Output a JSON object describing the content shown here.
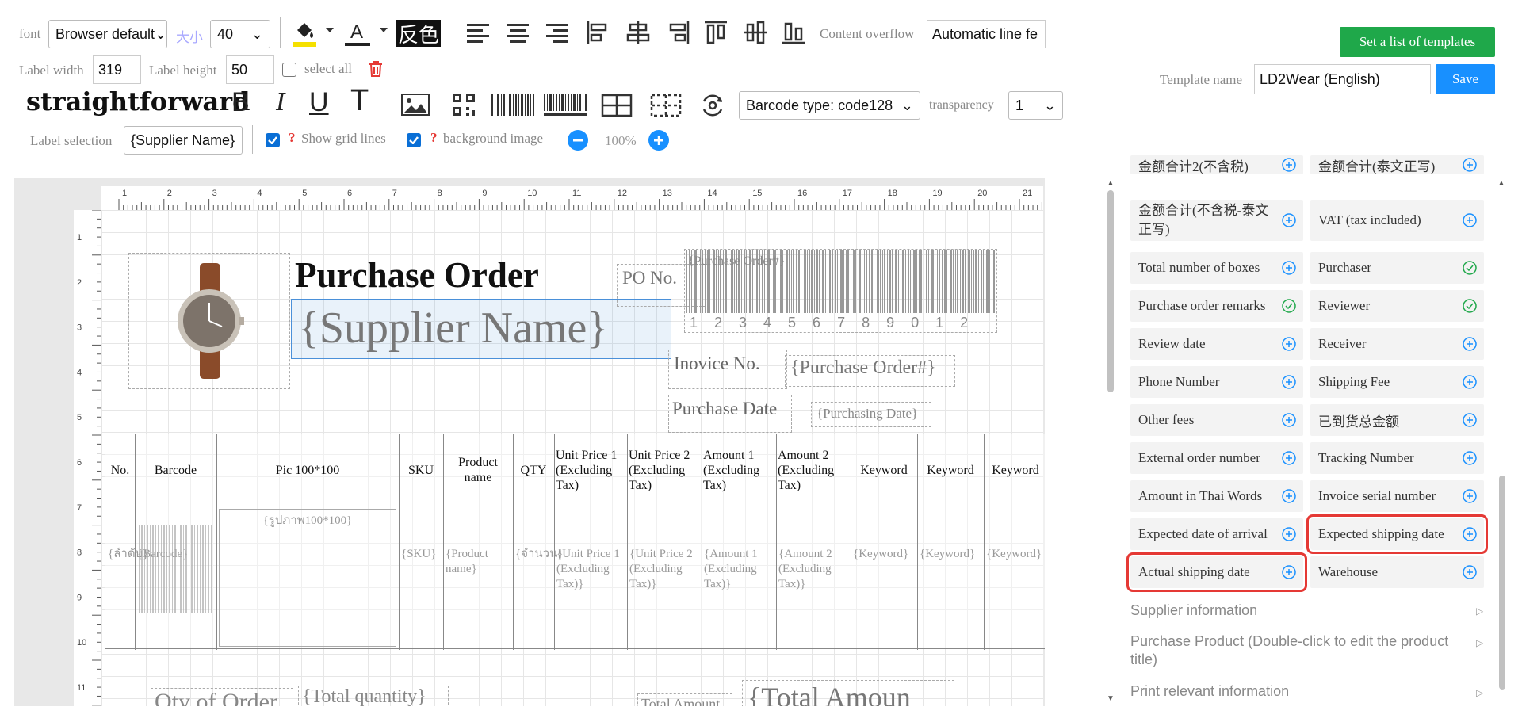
{
  "toolbar": {
    "font_label": "font",
    "font_value": "Browser default",
    "size_label": "大小",
    "size_value": "40",
    "invert_label": "反色",
    "overflow_label": "Content overflow",
    "overflow_value": "Automatic line fe",
    "label_width_label": "Label width",
    "label_width_value": "319",
    "label_height_label": "Label height",
    "label_height_value": "50",
    "select_all_label": "select all",
    "font_style_label": "straightforward",
    "bold": "B",
    "italic": "I",
    "underline": "U",
    "strike": "T",
    "barcode_type": "Barcode type: code128",
    "transparency_label": "transparency",
    "transparency_value": "1",
    "label_selection_label": "Label selection",
    "label_selection_value": "{Supplier Name}",
    "show_grid_label": "Show grid lines",
    "bg_image_label": "background image",
    "zoom": "100%",
    "help": "?"
  },
  "top_right": {
    "template_list_button": "Set a list of templates",
    "template_name_label": "Template name",
    "template_name_value": "LD2Wear (English)",
    "save_button": "Save"
  },
  "colors": {
    "accent": "#1890ff",
    "green": "#1fa84a",
    "highlight": "#e53935",
    "fill_underline": "#f5e000"
  },
  "ruler": {
    "top": [
      "1",
      "2",
      "3",
      "4",
      "5",
      "6",
      "7",
      "8",
      "9",
      "10",
      "11",
      "12",
      "13",
      "14",
      "15",
      "16",
      "17",
      "18",
      "19",
      "20",
      "21"
    ],
    "left": [
      "1",
      "2",
      "3",
      "4",
      "5",
      "6",
      "7",
      "8",
      "9",
      "10",
      "11"
    ]
  },
  "label": {
    "title": "Purchase Order",
    "supplier": "{Supplier Name}",
    "po_label": "PO No.",
    "po_barcode": "{Purchase Order#}",
    "barcode_digits": "1 2 3 4 5 6 7 8 9 0 1 2",
    "invoice_label": "Inovice No.",
    "invoice_value": "{Purchase Order#}",
    "date_label": "Purchase Date",
    "date_value": "{Purchasing Date}",
    "headers": [
      "No.",
      "Barcode",
      "Pic 100*100",
      "SKU",
      "Product name",
      "QTY",
      "Unit Price 1 (Excluding Tax)",
      "Unit Price 2 (Excluding Tax)",
      "Amount 1 (Excluding Tax)",
      "Amount 2 (Excluding Tax)",
      "Keyword",
      "Keyword",
      "Keyword"
    ],
    "cells": [
      "{ลำดับ}",
      "{Barcode}",
      "{รูปภาพ100*100}",
      "{SKU}",
      "{Product name}",
      "{จำนวน}",
      "{Unit Price 1 (Excluding Tax)}",
      "{Unit Price 2 (Excluding Tax)}",
      "{Amount 1 (Excluding Tax)}",
      "{Amount 2 (Excluding Tax)}",
      "{Keyword}",
      "{Keyword}",
      "{Keyword}"
    ],
    "qty_label": "Qty of Order",
    "qty_value": "{Total quantity}",
    "total_label": "Total Amount",
    "total_value": "{Total Amoun"
  },
  "panel": {
    "items": [
      {
        "label": "金额合计2(不含税)",
        "icon": "plus"
      },
      {
        "label": "金额合计(泰文正写)",
        "icon": "plus"
      },
      {
        "label": "金额合计(不含税-泰文正写)",
        "icon": "plus"
      },
      {
        "label": "VAT (tax included)",
        "icon": "plus"
      },
      {
        "label": "Total number of boxes",
        "icon": "plus"
      },
      {
        "label": "Purchaser",
        "icon": "check"
      },
      {
        "label": "Purchase order remarks",
        "icon": "check"
      },
      {
        "label": "Reviewer",
        "icon": "check"
      },
      {
        "label": "Review date",
        "icon": "plus"
      },
      {
        "label": "Receiver",
        "icon": "plus"
      },
      {
        "label": "Phone Number",
        "icon": "plus"
      },
      {
        "label": "Shipping Fee",
        "icon": "plus"
      },
      {
        "label": "Other fees",
        "icon": "plus"
      },
      {
        "label": "已到货总金额",
        "icon": "plus"
      },
      {
        "label": "External order number",
        "icon": "plus"
      },
      {
        "label": "Tracking Number",
        "icon": "plus"
      },
      {
        "label": "Amount in Thai Words",
        "icon": "plus"
      },
      {
        "label": "Invoice serial number",
        "icon": "plus"
      },
      {
        "label": "Expected date of arrival",
        "icon": "plus"
      },
      {
        "label": "Expected shipping date",
        "icon": "plus"
      },
      {
        "label": "Actual shipping date",
        "icon": "plus"
      },
      {
        "label": "Warehouse",
        "icon": "plus"
      }
    ],
    "groups": [
      "Supplier information",
      "Purchase Product (Double-click to edit the product title)",
      "Print relevant information"
    ]
  }
}
